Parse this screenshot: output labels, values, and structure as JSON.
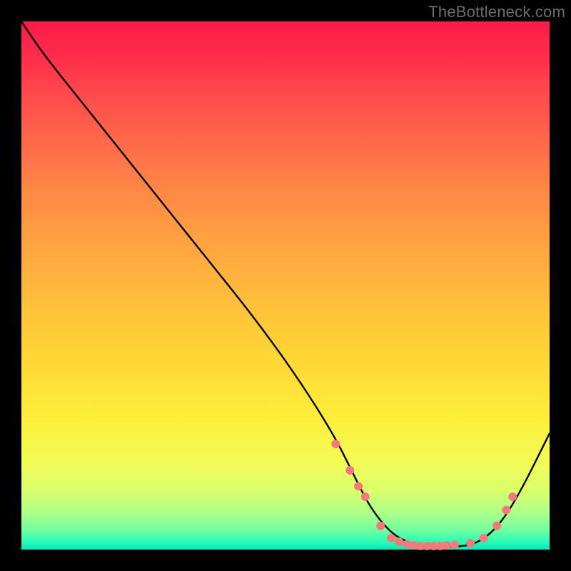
{
  "watermark": "TheBottleneck.com",
  "chart_data": {
    "type": "line",
    "title": "",
    "xlabel": "",
    "ylabel": "",
    "xlim": [
      0,
      100
    ],
    "ylim": [
      0,
      100
    ],
    "background_gradient": {
      "top_color": "#ff1a4b",
      "bottom_color": "#05e9c0",
      "description": "vertical red→yellow→green gradient"
    },
    "series": [
      {
        "name": "curve",
        "color": "#000000",
        "x": [
          0,
          4,
          12,
          20,
          28,
          36,
          44,
          52,
          59,
          63,
          66,
          70,
          74,
          78,
          82,
          86,
          90,
          94,
          100
        ],
        "y": [
          100,
          94,
          84,
          74,
          64,
          54,
          44,
          33,
          22,
          14,
          8,
          3,
          1,
          0.5,
          0.5,
          1,
          4,
          10,
          22
        ]
      }
    ],
    "markers": {
      "name": "dots",
      "color": "#f47a7a",
      "radius_px": 6,
      "x": [
        59.5,
        62.2,
        63.8,
        65.1,
        68.0,
        70.0,
        71.5,
        73.0,
        74.3,
        75.5,
        76.8,
        78.0,
        79.3,
        80.5,
        82.0,
        85.0,
        87.5,
        90.0,
        91.8,
        93.0
      ],
      "y": [
        20.0,
        15.0,
        12.0,
        10.0,
        4.5,
        2.2,
        1.5,
        1.0,
        0.8,
        0.7,
        0.7,
        0.7,
        0.7,
        0.8,
        0.9,
        1.2,
        2.2,
        4.5,
        7.5,
        10.0
      ]
    }
  }
}
